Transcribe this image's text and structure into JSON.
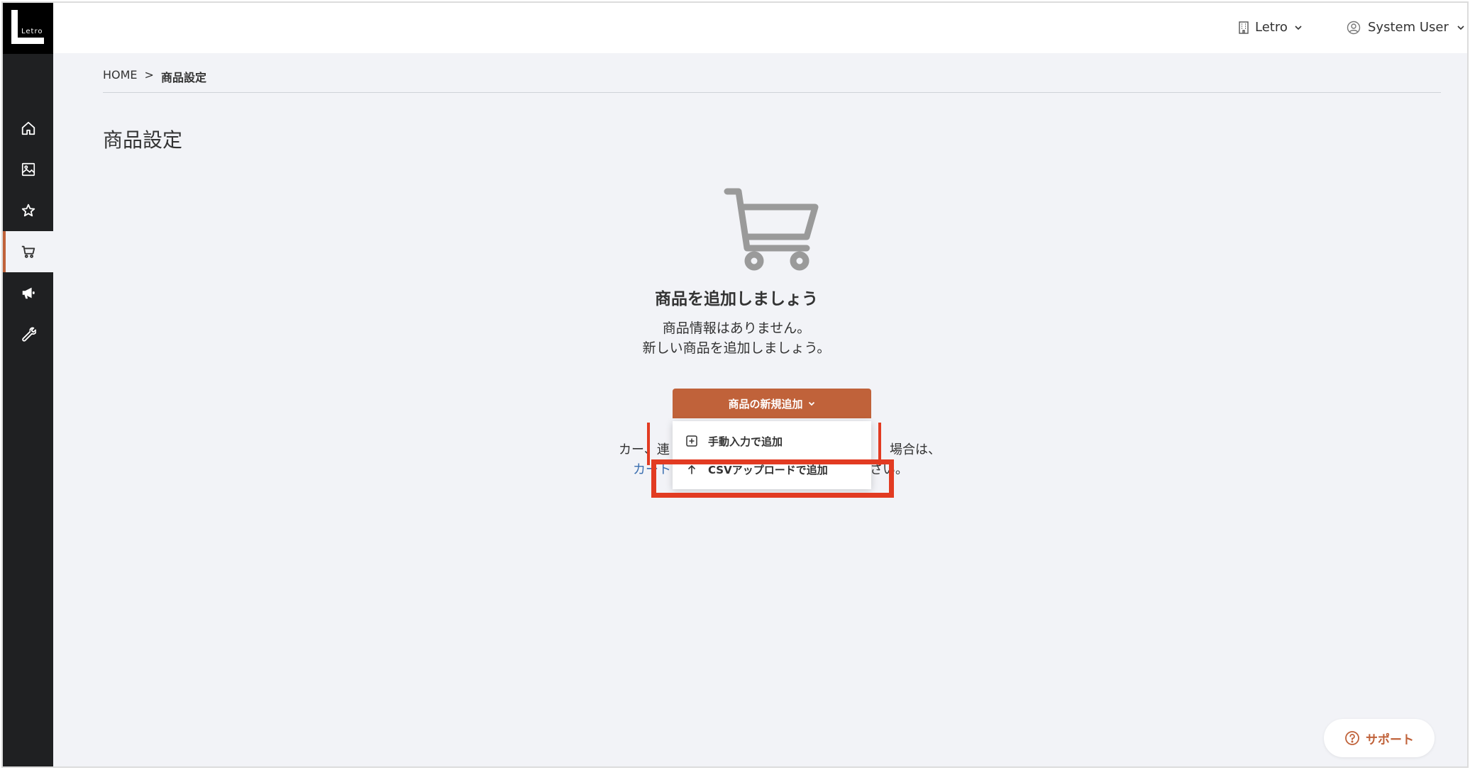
{
  "brand": {
    "logo_text": "Letro"
  },
  "sidebar": {
    "items": [
      {
        "icon": "home-icon"
      },
      {
        "icon": "image-icon"
      },
      {
        "icon": "star-icon"
      },
      {
        "icon": "cart-icon",
        "active": true
      },
      {
        "icon": "megaphone-icon"
      },
      {
        "icon": "wrench-icon"
      }
    ]
  },
  "header": {
    "org_label": "Letro",
    "user_label": "System User"
  },
  "breadcrumb": {
    "home": "HOME",
    "separator": ">",
    "current": "商品設定"
  },
  "main": {
    "title": "商品設定",
    "empty_state": {
      "icon": "cart-icon",
      "heading": "商品を追加しましょう",
      "line1": "商品情報はありません。",
      "line2": "新しい商品を追加しましょう。"
    },
    "add_button_label": "商品の新規追加",
    "dropdown": {
      "items": [
        {
          "icon": "plus-square-icon",
          "label": "手動入力で追加"
        },
        {
          "icon": "upload-arrow-icon",
          "label": "CSVアップロードで追加"
        }
      ]
    },
    "hint": {
      "part1": "カー、連",
      "part2": "場合は、",
      "part3": "カート",
      "part4": "さい。"
    }
  },
  "support": {
    "label": "サポート"
  },
  "colors": {
    "accent": "#c0623a",
    "sidebar_bg": "#1f2022",
    "highlight": "#e23b22",
    "link": "#3b6fb0"
  }
}
